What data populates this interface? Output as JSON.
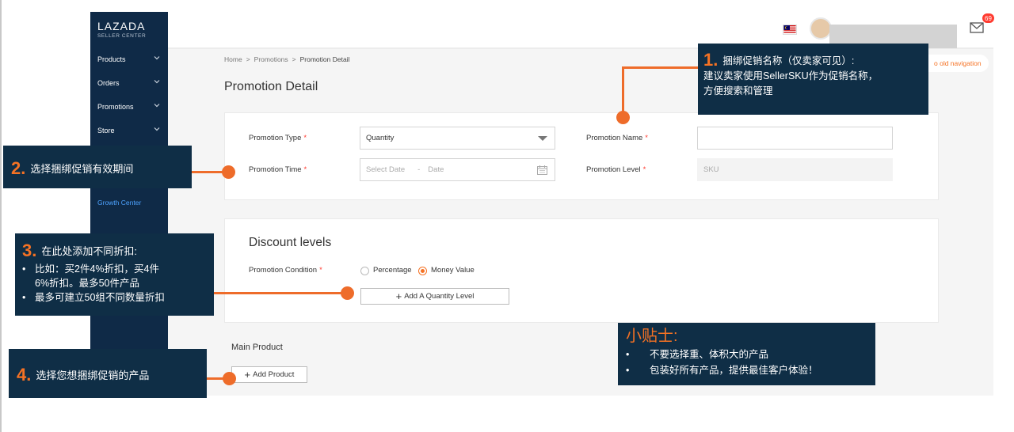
{
  "sidebar": {
    "logo_main": "LAZADA",
    "logo_sub": "SELLER CENTER",
    "items": [
      {
        "label": "Products"
      },
      {
        "label": "Orders"
      },
      {
        "label": "Promotions"
      },
      {
        "label": "Store"
      }
    ],
    "growth_center": "Growth Center"
  },
  "topbar": {
    "notification_count": "69",
    "old_navigation": "o old navigation"
  },
  "breadcrumb": [
    "Home",
    "Promotions",
    "Promotion Detail"
  ],
  "breadcrumb_separator": ">",
  "page_title": "Promotion Detail",
  "form": {
    "promotion_type_label": "Promotion Type",
    "promotion_type_value": "Quantity",
    "promotion_name_label": "Promotion Name",
    "promotion_name_value": "",
    "promotion_time_label": "Promotion Time",
    "start_date_placeholder": "Select Date",
    "date_separator": "-",
    "end_date_placeholder": "Date",
    "promotion_level_label": "Promotion Level",
    "promotion_level_value": "SKU",
    "required_mark": "*"
  },
  "discount": {
    "title": "Discount levels",
    "condition_label": "Promotion Condition",
    "option_percentage": "Percentage",
    "option_money": "Money Value",
    "selected": "Money Value",
    "add_level_button": "Add A Quantity Level"
  },
  "main_product": {
    "title": "Main Product",
    "add_button": "Add Product"
  },
  "annotations": {
    "a1": {
      "num": "1.",
      "line1": "捆绑促销名称（仅卖家可见）:",
      "line2": "建议卖家使用SellerSKU作为促销名称，",
      "line3": "方便搜索和管理"
    },
    "a2": {
      "num": "2.",
      "text": "选择捆绑促销有效期间"
    },
    "a3": {
      "num": "3.",
      "title": "在此处添加不同折扣:",
      "b1a": "比如：买2件4%折扣，买4件",
      "b1b": "6%折扣。最多50件产品",
      "b2": "最多可建立50组不同数量折扣",
      "bullet": "•"
    },
    "a4": {
      "num": "4.",
      "text": "选择您想捆绑促销的产品"
    },
    "tips": {
      "title": "小贴士:",
      "b1": "不要选择重、体积大的产品",
      "b2": "包装好所有产品，提供最佳客户体验！",
      "bullet": "•"
    }
  },
  "colors": {
    "sidebar_bg": "#0f2a47",
    "annotation_bg": "#0f2e46",
    "accent_orange": "#f57224",
    "link_blue": "#4da3ff",
    "badge_red": "#ff3b30"
  },
  "icons": [
    "chevron-down-icon",
    "flag-icon",
    "mail-icon",
    "calendar-icon",
    "plus-icon",
    "caret-down-icon"
  ]
}
